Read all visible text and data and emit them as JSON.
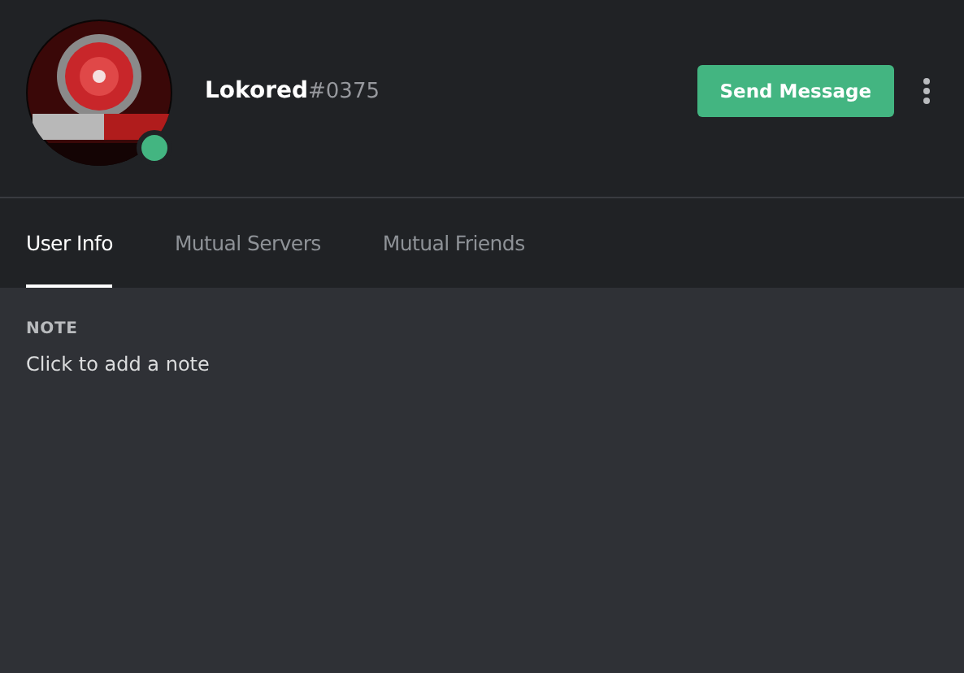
{
  "profile": {
    "online": true,
    "username": "Lokored",
    "discriminator": "#0375"
  },
  "actions": {
    "primary_button": "Send Message"
  },
  "tabs": [
    {
      "label": "User Info",
      "selected": true
    },
    {
      "label": "Mutual Servers",
      "selected": false
    },
    {
      "label": "Mutual Friends",
      "selected": false
    }
  ],
  "note": {
    "heading": "NOTE",
    "placeholder": "Click to add a note"
  }
}
